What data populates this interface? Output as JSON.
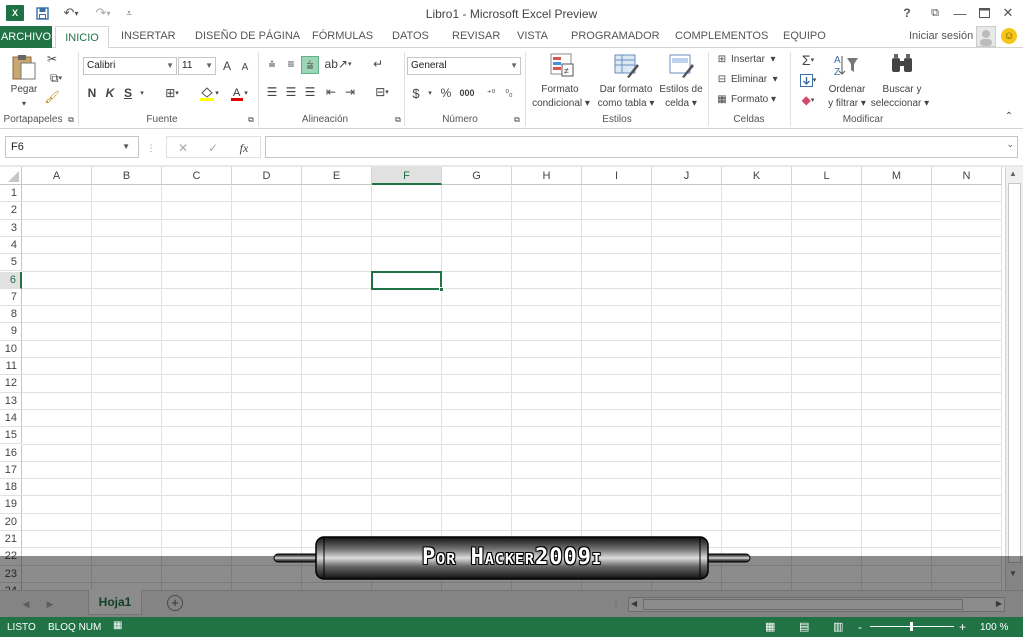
{
  "window": {
    "title": "Libro1 - Microsoft Excel Preview",
    "help": "?",
    "restore": "□",
    "minimize": "—",
    "maximize": "☐",
    "close": "✕"
  },
  "quick_access": {
    "logo": "X",
    "save_icon": "save-icon",
    "undo_icon": "undo-icon",
    "redo_icon": "redo-icon",
    "customize_icon": "customize-icon"
  },
  "tabs": [
    {
      "label": "ARCHIVO"
    },
    {
      "label": "INICIO"
    },
    {
      "label": "INSERTAR"
    },
    {
      "label": "DISEÑO DE PÁGINA"
    },
    {
      "label": "FÓRMULAS"
    },
    {
      "label": "DATOS"
    },
    {
      "label": "REVISAR"
    },
    {
      "label": "VISTA"
    },
    {
      "label": "PROGRAMADOR"
    },
    {
      "label": "COMPLEMENTOS"
    },
    {
      "label": "EQUIPO"
    }
  ],
  "account": {
    "signin": "Iniciar sesión"
  },
  "ribbon": {
    "clipboard": {
      "paste": "Pegar",
      "label": "Portapapeles"
    },
    "font": {
      "family": "Calibri",
      "size": "11",
      "bold": "N",
      "italic": "K",
      "underline": "S",
      "grow": "A",
      "shrink": "A",
      "label": "Fuente"
    },
    "alignment": {
      "label": "Alineación"
    },
    "number": {
      "format": "General",
      "currency": "$",
      "percent": "%",
      "thousands": "000",
      "label": "Número"
    },
    "styles": {
      "conditional_1": "Formato",
      "conditional_2": "condicional",
      "table_1": "Dar formato",
      "table_2": "como tabla",
      "cell_1": "Estilos de",
      "cell_2": "celda",
      "label": "Estilos"
    },
    "cells": {
      "insert": "Insertar",
      "delete": "Eliminar",
      "format": "Formato",
      "label": "Celdas"
    },
    "editing": {
      "sort_1": "Ordenar",
      "sort_2": "y filtrar",
      "find_1": "Buscar y",
      "find_2": "seleccionar",
      "label": "Modificar"
    }
  },
  "formula_bar": {
    "name_box": "F6",
    "fx": "fx",
    "value": ""
  },
  "grid": {
    "columns": [
      "A",
      "B",
      "C",
      "D",
      "E",
      "F",
      "G",
      "H",
      "I",
      "J",
      "K",
      "L",
      "M",
      "N"
    ],
    "rows": [
      "1",
      "2",
      "3",
      "4",
      "5",
      "6",
      "7",
      "8",
      "9",
      "10",
      "11",
      "12",
      "13",
      "14",
      "15",
      "16",
      "17",
      "18",
      "19",
      "20",
      "21",
      "22",
      "23",
      "24"
    ],
    "selected_cell": "F6"
  },
  "sheets": [
    {
      "label": "Hoja1"
    }
  ],
  "add_sheet": "+",
  "status": {
    "ready": "LISTO",
    "numlock": "BLOQ NUM",
    "zoom": "100 %",
    "zoom_minus": "-",
    "zoom_plus": "+"
  },
  "overlay": {
    "banner_text": "Por Hacker2009i"
  },
  "colors": {
    "accent": "#217346",
    "selection": "#217346"
  }
}
